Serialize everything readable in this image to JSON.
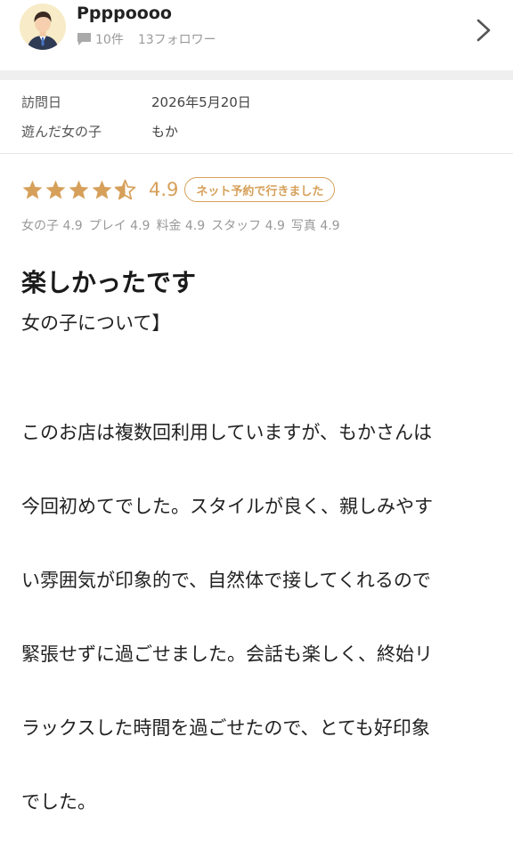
{
  "user": {
    "name": "Ppppoooo",
    "review_count": "10件",
    "followers": "13フォロワー"
  },
  "visit": {
    "date_label": "訪問日",
    "date_value": "2026年5月20日",
    "girl_label": "遊んだ女の子",
    "girl_value": "もか"
  },
  "rating": {
    "stars": 4.5,
    "value": "4.9",
    "badge": "ネット予約で行きました",
    "star_color": "#d6a05a"
  },
  "subscores": [
    "女の子 4.9",
    "プレイ 4.9",
    "料金 4.9",
    "スタッフ 4.9",
    "写真 4.9"
  ],
  "review": {
    "title": "楽しかったです",
    "subtitle": "女の子について】",
    "body_lines": [
      "このお店は複数回利用していますが、もかさんは",
      "今回初めてでした。スタイルが良く、親しみやす",
      "い雰囲気が印象的で、自然体で接してくれるので",
      "緊張せずに過ごせました。会話も楽しく、終始リ",
      "ラックスした時間を過ごせたので、とても好印象",
      "でした。"
    ]
  },
  "icons": {
    "avatar": "user-avatar-icon",
    "comment": "comment-icon",
    "chevron": "chevron-right-icon"
  }
}
